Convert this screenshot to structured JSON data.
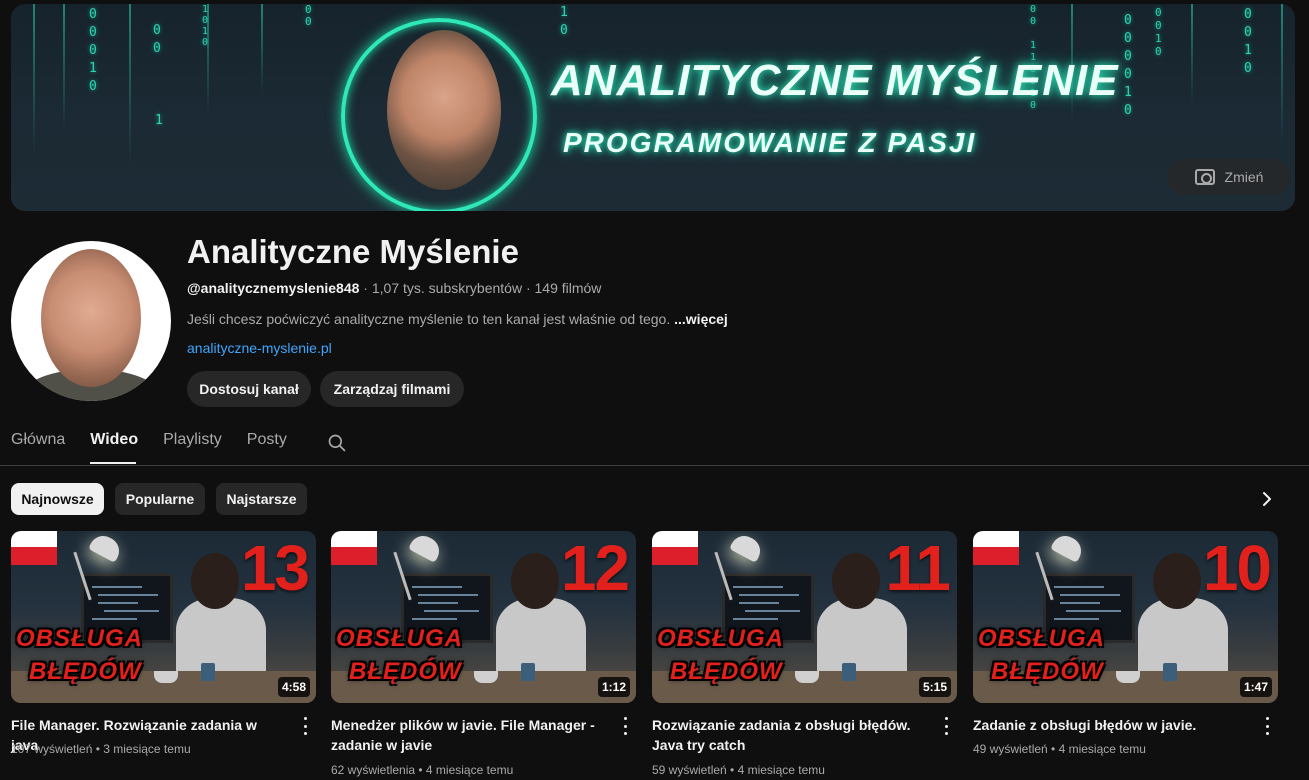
{
  "banner": {
    "title": "ANALITYCZNE MYŚLENIE",
    "subtitle": "PROGRAMOWANIE Z PASJI",
    "change_label": "Zmień",
    "matrix_columns": [
      "0\n0\n0\n1\n0",
      "0\n0",
      "1\n0\n1\n0",
      "1",
      "0\n0",
      "1\n0",
      "0\n0\n\n1\n1\n0\n0\n1\n0",
      "0\n0\n0\n0\n1\n0",
      "0\n0\n1\n0",
      "0\n0\n1\n0"
    ]
  },
  "channel": {
    "name": "Analityczne Myślenie",
    "handle": "@analitycznemyslenie848",
    "stats": " · 1,07 tys. subskrybentów · 149 filmów",
    "description": "Jeśli chcesz poćwiczyć analityczne myślenie to ten kanał jest właśnie od tego. ",
    "more_label": "...więcej",
    "link": "analityczne-myslenie.pl",
    "customize_label": "Dostosuj kanał",
    "manage_label": "Zarządzaj filmami"
  },
  "tabs": [
    "Główna",
    "Wideo",
    "Playlisty",
    "Posty"
  ],
  "chips": [
    "Najnowsze",
    "Popularne",
    "Najstarsze"
  ],
  "videos": [
    {
      "number": "13",
      "overlay_line1": "OBSŁUGA",
      "overlay_line2": "BŁĘDÓW",
      "duration": "4:58",
      "title": "File Manager. Rozwiązanie zadania w java",
      "meta": "107 wyświetleń • 3 miesiące temu"
    },
    {
      "number": "12",
      "overlay_line1": "OBSŁUGA",
      "overlay_line2": "BŁĘDÓW",
      "duration": "1:12",
      "title": "Menedżer plików w javie. File Manager - zadanie w javie",
      "meta": "62 wyświetlenia • 4 miesiące temu"
    },
    {
      "number": "11",
      "overlay_line1": "OBSŁUGA",
      "overlay_line2": "BŁĘDÓW",
      "duration": "5:15",
      "title": "Rozwiązanie zadania z obsługi błędów. Java try catch",
      "meta": "59 wyświetleń • 4 miesiące temu"
    },
    {
      "number": "10",
      "overlay_line1": "OBSŁUGA",
      "overlay_line2": "BŁĘDÓW",
      "duration": "1:47",
      "title": "Zadanie z obsługi błędów w javie.",
      "meta": "49 wyświetleń • 4 miesiące temu"
    }
  ]
}
